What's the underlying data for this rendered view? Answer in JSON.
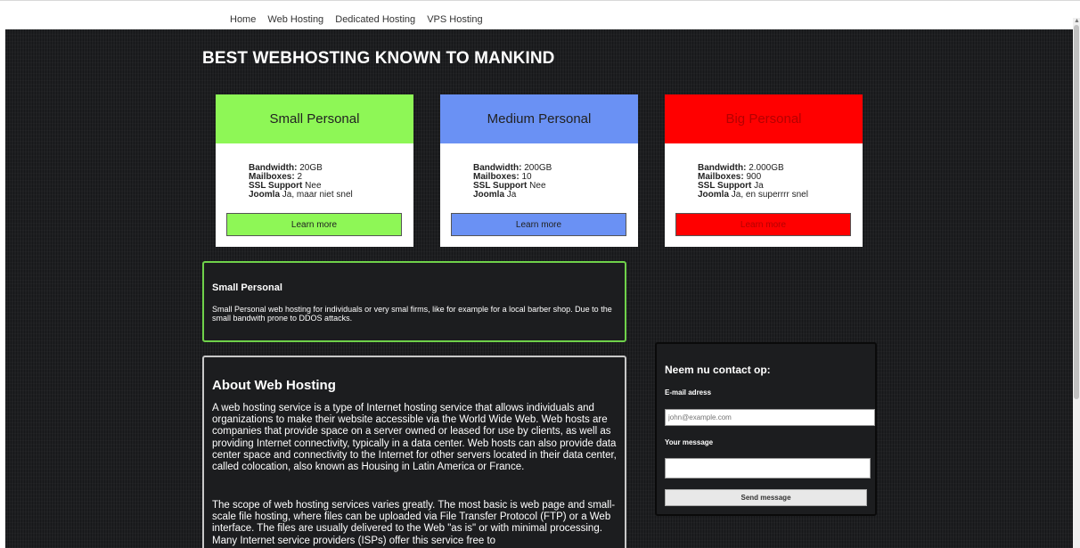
{
  "nav": {
    "items": [
      "Home",
      "Web Hosting",
      "Dedicated Hosting",
      "VPS Hosting"
    ]
  },
  "page": {
    "title": "BEST WEBHOSTING KNOWN TO MANKIND"
  },
  "plans": [
    {
      "name": "Small Personal",
      "color": "#8ef756",
      "bandwidth_label": "Bandwidth:",
      "bandwidth": "20GB",
      "mailboxes_label": "Mailboxes:",
      "mailboxes": "2",
      "ssl_label": "SSL Support",
      "ssl": "Nee",
      "joomla_label": "Joomla",
      "joomla": "Ja, maar niet snel",
      "button": "Learn more"
    },
    {
      "name": "Medium Personal",
      "color": "#6a91f4",
      "bandwidth_label": "Bandwidth:",
      "bandwidth": "200GB",
      "mailboxes_label": "Mailboxes:",
      "mailboxes": "10",
      "ssl_label": "SSL Support",
      "ssl": "Nee",
      "joomla_label": "Joomla",
      "joomla": "Ja",
      "button": "Learn more"
    },
    {
      "name": "Big Personal",
      "color": "#ff0000",
      "bandwidth_label": "Bandwidth:",
      "bandwidth": "2.000GB",
      "mailboxes_label": "Mailboxes:",
      "mailboxes": "900",
      "ssl_label": "SSL Support",
      "ssl": "Ja",
      "joomla_label": "Joomla",
      "joomla": "Ja, en superrrr snel",
      "button": "Learn more"
    }
  ],
  "detail": {
    "title": "Small Personal",
    "text": "Small Personal web hosting for individuals or very smal firms, like for example for a local barber shop. Due to the small bandwith prone to DDOS attacks."
  },
  "about": {
    "title": "About Web Hosting",
    "p1": "A web hosting service is a type of Internet hosting service that allows individuals and organizations to make their website accessible via the World Wide Web. Web hosts are companies that provide space on a server owned or leased for use by clients, as well as providing Internet connectivity, typically in a data center. Web hosts can also provide data center space and connectivity to the Internet for other servers located in their data center, called colocation, also known as Housing in Latin America or France.",
    "p2": "The scope of web hosting services varies greatly. The most basic is web page and small-scale file hosting, where files can be uploaded via File Transfer Protocol (FTP) or a Web interface. The files are usually delivered to the Web \"as is\" or with minimal processing. Many Internet service providers (ISPs) offer this service free to"
  },
  "contact": {
    "title": "Neem nu contact op:",
    "email_label": "E-mail adress",
    "email_placeholder": "john@example.com",
    "message_label": "Your message",
    "send": "Send message"
  }
}
